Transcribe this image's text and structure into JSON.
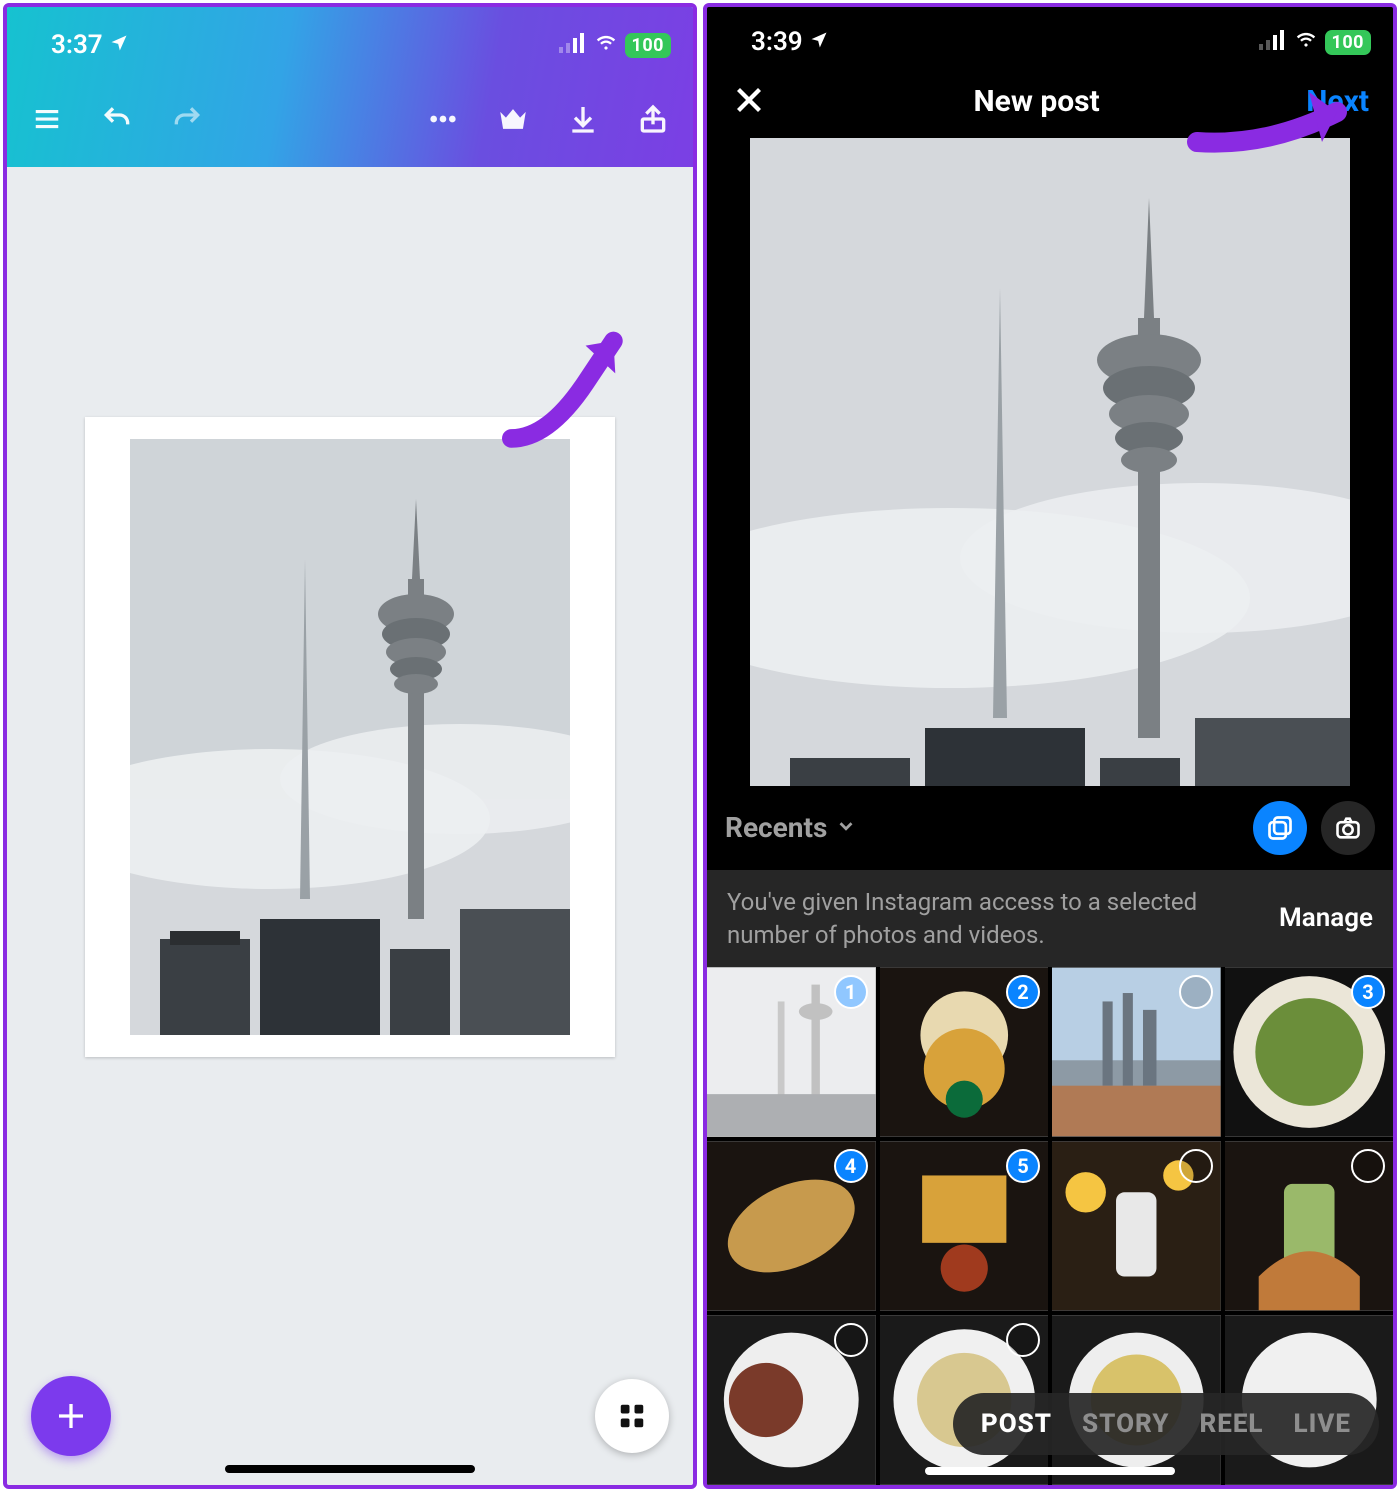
{
  "left": {
    "status": {
      "time": "3:37",
      "battery": "100"
    },
    "toolbar": {
      "menu": "menu",
      "undo": "undo",
      "redo": "redo",
      "more": "more",
      "crown": "premium",
      "download": "download",
      "share": "share"
    },
    "fab_plus": "+",
    "annotation": "arrow-to-download"
  },
  "right": {
    "status": {
      "time": "3:39",
      "battery": "100"
    },
    "header": {
      "close": "close",
      "title": "New post",
      "next": "Next"
    },
    "album": {
      "label": "Recents",
      "multi": "multi-select",
      "camera": "camera"
    },
    "access": {
      "message": "You've given Instagram access to a selected number of photos and videos.",
      "manage": "Manage"
    },
    "grid": [
      {
        "sel": "1",
        "desc": "tower-photo",
        "kind": "selected"
      },
      {
        "sel": "2",
        "desc": "iced-drink"
      },
      {
        "sel": "",
        "desc": "city-skyline"
      },
      {
        "sel": "3",
        "desc": "green-pasta"
      },
      {
        "sel": "4",
        "desc": "garlic-bread"
      },
      {
        "sel": "5",
        "desc": "fries"
      },
      {
        "sel": "",
        "desc": "cocktail-night"
      },
      {
        "sel": "",
        "desc": "green-drink"
      },
      {
        "sel": "",
        "desc": "pastry-plate"
      },
      {
        "sel": "",
        "desc": "soup-bowl"
      },
      {
        "sel": "",
        "desc": "noodles"
      },
      {
        "sel": "",
        "desc": "dessert"
      }
    ],
    "modes": [
      {
        "label": "POST",
        "active": true
      },
      {
        "label": "STORY",
        "active": false
      },
      {
        "label": "REEL",
        "active": false
      },
      {
        "label": "LIVE",
        "active": false
      }
    ],
    "annotation": "arrow-to-next"
  }
}
